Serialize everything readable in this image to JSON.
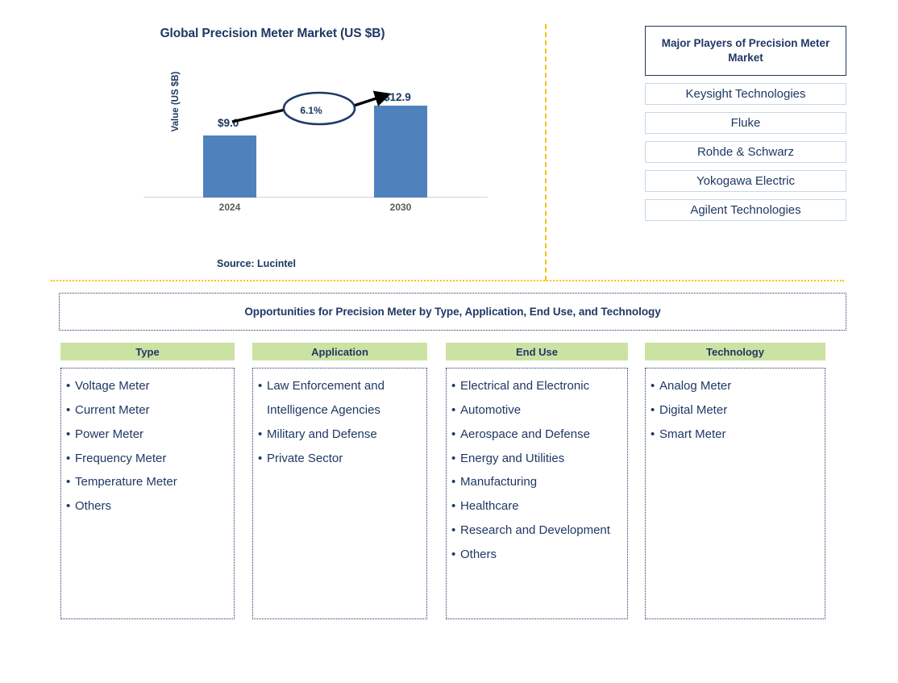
{
  "chart_data": {
    "type": "bar",
    "title": "Global Precision Meter Market (US $B)",
    "ylabel": "Value (US $B)",
    "xlabel": "",
    "categories": [
      "2024",
      "2030"
    ],
    "values": [
      9.0,
      12.9
    ],
    "value_labels": [
      "$9.0",
      "$12.9"
    ],
    "ylim": [
      0,
      14.5
    ],
    "grid": false,
    "legend": "none",
    "annotations": [
      {
        "name": "cagr",
        "text": "6.1%",
        "shape": "ellipse-with-arrow",
        "from": "2024",
        "to": "2030"
      }
    ],
    "bar_color": "#4f81bd",
    "source": "Source: Lucintel"
  },
  "chart": {
    "title": "Global Precision Meter Market (US $B)",
    "y_axis_label": "Value (US $B)",
    "bars": [
      {
        "year": "2024",
        "label": "$9.0"
      },
      {
        "year": "2030",
        "label": "$12.9"
      }
    ],
    "cagr": "6.1%",
    "source": "Source: Lucintel"
  },
  "players": {
    "title": "Major Players of Precision Meter Market",
    "items": [
      {
        "name": "Keysight Technologies"
      },
      {
        "name": "Fluke"
      },
      {
        "name": "Rohde & Schwarz"
      },
      {
        "name": "Yokogawa Electric"
      },
      {
        "name": "Agilent Technologies"
      }
    ]
  },
  "opportunities": {
    "heading": "Opportunities for Precision Meter by Type, Application, End Use, and Technology",
    "columns": [
      {
        "header": "Type",
        "items": [
          "Voltage Meter",
          "Current Meter",
          "Power Meter",
          "Frequency Meter",
          "Temperature Meter",
          "Others"
        ]
      },
      {
        "header": "Application",
        "items": [
          "Law Enforcement and Intelligence Agencies",
          "Military and Defense",
          "Private Sector"
        ]
      },
      {
        "header": "End Use",
        "items": [
          "Electrical and Electronic",
          "Automotive",
          "Aerospace and Defense",
          "Energy and Utilities",
          "Manufacturing",
          "Healthcare",
          "Research and Development",
          "Others"
        ]
      },
      {
        "header": "Technology",
        "items": [
          "Analog Meter",
          "Digital Meter",
          "Smart Meter"
        ]
      }
    ]
  },
  "colors": {
    "navy": "#1f3864",
    "bar_blue": "#4f81bd",
    "header_green": "#cce2a3",
    "divider_orange": "#ffc000",
    "player_border": "#c5d9e8"
  }
}
